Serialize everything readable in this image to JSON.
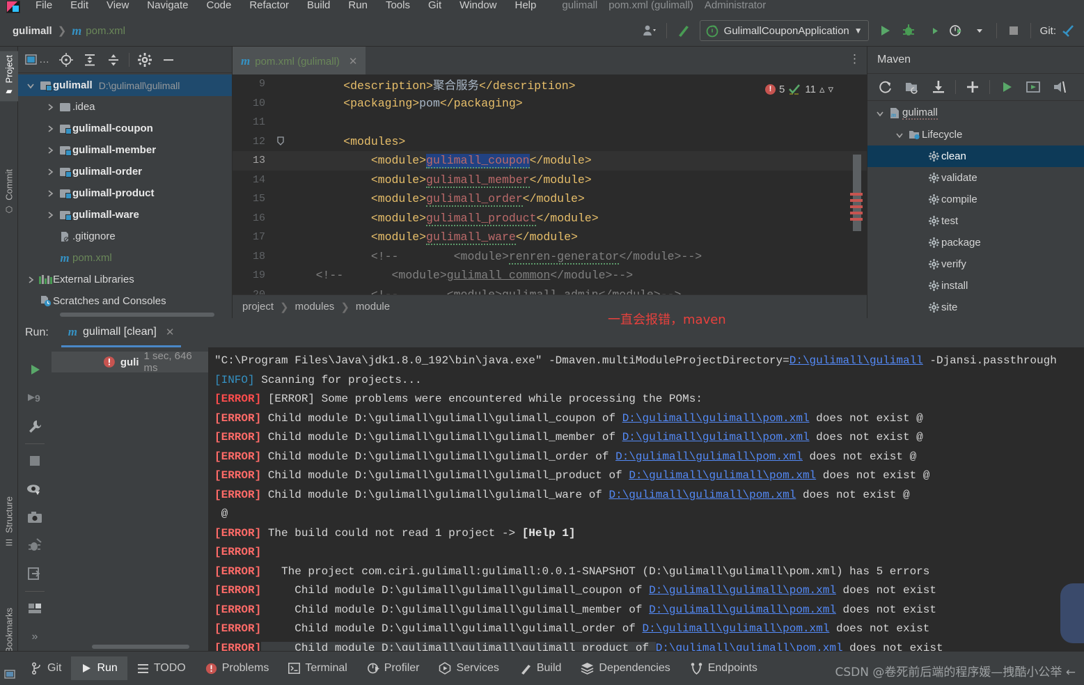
{
  "menu": {
    "items": [
      "File",
      "Edit",
      "View",
      "Navigate",
      "Code",
      "Refactor",
      "Build",
      "Run",
      "Tools",
      "Git",
      "Window",
      "Help"
    ],
    "window_title": [
      "gulimall",
      "pom.xml (gulimall)",
      "Administrator"
    ]
  },
  "toolbar": {
    "breadcrumb_project": "gulimall",
    "breadcrumb_file": "pom.xml",
    "m_icon": "m",
    "run_config": "GulimallCouponApplication",
    "git_label": "Git:",
    "icons": [
      "user-icon",
      "build-hammer-icon",
      "run-icon",
      "debug-icon",
      "run-with-coverage-icon",
      "profiler-icon",
      "stop-icon",
      "git-update-icon"
    ]
  },
  "left_strip": {
    "tabs": [
      {
        "label": "Project",
        "icon": "folder-icon",
        "selected": true
      },
      {
        "label": "Commit",
        "icon": "commit-icon",
        "selected": false
      },
      {
        "label": "Structure",
        "icon": "structure-icon",
        "selected": false
      },
      {
        "label": "Bookmarks",
        "icon": "bookmark-icon",
        "selected": false
      }
    ]
  },
  "project_window": {
    "toolbar_icons": [
      "project-view-select",
      "locate-icon",
      "expand-all-icon",
      "collapse-all-icon",
      "settings-gear-icon",
      "hide-icon"
    ],
    "tree": [
      {
        "label": "gulimall",
        "path": "D:\\gulimall\\gulimall",
        "depth": 0,
        "twist": "expanded",
        "icon": "module-folder-icon",
        "bold": true,
        "selected": true
      },
      {
        "label": ".idea",
        "path": "",
        "depth": 1,
        "twist": "collapsed",
        "icon": "folder-icon",
        "bold": false,
        "selected": false
      },
      {
        "label": "gulimall-coupon",
        "path": "",
        "depth": 1,
        "twist": "collapsed",
        "icon": "module-folder-icon",
        "bold": true,
        "selected": false
      },
      {
        "label": "gulimall-member",
        "path": "",
        "depth": 1,
        "twist": "collapsed",
        "icon": "module-folder-icon",
        "bold": true,
        "selected": false
      },
      {
        "label": "gulimall-order",
        "path": "",
        "depth": 1,
        "twist": "collapsed",
        "icon": "module-folder-icon",
        "bold": true,
        "selected": false
      },
      {
        "label": "gulimall-product",
        "path": "",
        "depth": 1,
        "twist": "collapsed",
        "icon": "module-folder-icon",
        "bold": true,
        "selected": false
      },
      {
        "label": "gulimall-ware",
        "path": "",
        "depth": 1,
        "twist": "collapsed",
        "icon": "module-folder-icon",
        "bold": true,
        "selected": false
      },
      {
        "label": ".gitignore",
        "path": "",
        "depth": 1,
        "twist": "none",
        "icon": "gitignore-file-icon",
        "bold": false,
        "selected": false
      },
      {
        "label": "pom.xml",
        "path": "",
        "depth": 1,
        "twist": "none",
        "icon": "maven-file-icon",
        "bold": false,
        "selected": false
      },
      {
        "label": "External Libraries",
        "path": "",
        "depth": 0,
        "twist": "collapsed",
        "icon": "libraries-icon",
        "bold": false,
        "selected": false
      },
      {
        "label": "Scratches and Consoles",
        "path": "",
        "depth": 0,
        "twist": "none",
        "icon": "scratches-icon",
        "bold": false,
        "selected": false
      }
    ]
  },
  "editor": {
    "tab_label": "pom.xml (gulimall)",
    "tab_icon": "maven-file-icon",
    "inspection": {
      "error_count": "5",
      "warning_count": "11",
      "error_glyph": "!",
      "check_glyph": "✓"
    },
    "breadcrumb": [
      "project",
      "modules",
      "module"
    ],
    "annotation": "一直会报错，maven",
    "lines": [
      {
        "num": "9",
        "indent": 8,
        "fold": false,
        "current": false,
        "parts": [
          {
            "t": "tag",
            "s": "<description>"
          },
          {
            "t": "txt",
            "s": "聚合服务"
          },
          {
            "t": "tag",
            "s": "</description>"
          }
        ]
      },
      {
        "num": "10",
        "indent": 8,
        "fold": false,
        "current": false,
        "parts": [
          {
            "t": "tag",
            "s": "<packaging>"
          },
          {
            "t": "txt",
            "s": "pom"
          },
          {
            "t": "tag",
            "s": "</packaging>"
          }
        ]
      },
      {
        "num": "11",
        "indent": 0,
        "fold": false,
        "current": false,
        "parts": []
      },
      {
        "num": "12",
        "indent": 8,
        "fold": true,
        "current": false,
        "parts": [
          {
            "t": "tag",
            "s": "<modules>"
          }
        ]
      },
      {
        "num": "13",
        "indent": 12,
        "fold": false,
        "current": true,
        "parts": [
          {
            "t": "tag",
            "s": "<module>"
          },
          {
            "t": "sel",
            "s": "gulimall_coupon"
          },
          {
            "t": "tag",
            "s": "</module>"
          }
        ]
      },
      {
        "num": "14",
        "indent": 12,
        "fold": false,
        "current": false,
        "parts": [
          {
            "t": "tag",
            "s": "<module>"
          },
          {
            "t": "valw",
            "s": "gulimall_member"
          },
          {
            "t": "tag",
            "s": "</module>"
          }
        ]
      },
      {
        "num": "15",
        "indent": 12,
        "fold": false,
        "current": false,
        "parts": [
          {
            "t": "tag",
            "s": "<module>"
          },
          {
            "t": "valw",
            "s": "gulimall_order"
          },
          {
            "t": "tag",
            "s": "</module>"
          }
        ]
      },
      {
        "num": "16",
        "indent": 12,
        "fold": false,
        "current": false,
        "parts": [
          {
            "t": "tag",
            "s": "<module>"
          },
          {
            "t": "valw",
            "s": "gulimall_product"
          },
          {
            "t": "tag",
            "s": "</module>"
          }
        ]
      },
      {
        "num": "17",
        "indent": 12,
        "fold": false,
        "current": false,
        "parts": [
          {
            "t": "tag",
            "s": "<module>"
          },
          {
            "t": "valw",
            "s": "gulimall_ware"
          },
          {
            "t": "tag",
            "s": "</module>"
          }
        ]
      },
      {
        "num": "18",
        "indent": 12,
        "fold": false,
        "current": false,
        "parts": [
          {
            "t": "cmt",
            "s": "<!--        <module>"
          },
          {
            "t": "cmtw",
            "s": "renren-generator"
          },
          {
            "t": "cmt",
            "s": "</module>-->"
          }
        ]
      },
      {
        "num": "19",
        "indent": 4,
        "fold": false,
        "current": false,
        "parts": [
          {
            "t": "cmt",
            "s": "<!--       <module>"
          },
          {
            "t": "cmtu",
            "s": "gulimall_common"
          },
          {
            "t": "cmt",
            "s": "</module>-->"
          }
        ]
      },
      {
        "num": "20",
        "indent": 12,
        "fold": false,
        "current": false,
        "parts": [
          {
            "t": "cmt",
            "s": "<!--       <module>gulimall_admin</module>-->"
          }
        ]
      }
    ]
  },
  "maven_window": {
    "title": "Maven",
    "toolbar_icons": [
      "reload-icon",
      "add-maven-projects-icon",
      "download-sources-icon",
      "plus-icon",
      "run-icon",
      "execute-goal-icon",
      "toggle-offline-icon"
    ],
    "tree": [
      {
        "label": "gulimall",
        "depth": 0,
        "twist": "expanded",
        "icon": "maven-project-icon",
        "selected": false
      },
      {
        "label": "Lifecycle",
        "depth": 1,
        "twist": "expanded",
        "icon": "lifecycle-folder-icon",
        "selected": false
      },
      {
        "label": "clean",
        "depth": 2,
        "twist": "none",
        "icon": "goal-gear-icon",
        "selected": true
      },
      {
        "label": "validate",
        "depth": 2,
        "twist": "none",
        "icon": "goal-gear-icon",
        "selected": false
      },
      {
        "label": "compile",
        "depth": 2,
        "twist": "none",
        "icon": "goal-gear-icon",
        "selected": false
      },
      {
        "label": "test",
        "depth": 2,
        "twist": "none",
        "icon": "goal-gear-icon",
        "selected": false
      },
      {
        "label": "package",
        "depth": 2,
        "twist": "none",
        "icon": "goal-gear-icon",
        "selected": false
      },
      {
        "label": "verify",
        "depth": 2,
        "twist": "none",
        "icon": "goal-gear-icon",
        "selected": false
      },
      {
        "label": "install",
        "depth": 2,
        "twist": "none",
        "icon": "goal-gear-icon",
        "selected": false
      },
      {
        "label": "site",
        "depth": 2,
        "twist": "none",
        "icon": "goal-gear-icon",
        "selected": false
      }
    ]
  },
  "run_window": {
    "label": "Run:",
    "tab_label": "gulimall [clean]",
    "tab_icon": "maven-file-icon",
    "side_icons": [
      "rerun-icon",
      "rerun-failed-icon",
      "configure-wrench-icon",
      "stop-icon",
      "toggle-tasks-icon",
      "screenshot-icon",
      "debug-icon",
      "export-icon",
      "layout-icon",
      "more-icon"
    ],
    "tree_node": {
      "name": "guli",
      "time": "1 sec, 646 ms",
      "icon": "error-badge-icon"
    },
    "console": [
      {
        "parts": [
          {
            "t": "n",
            "s": "\"C:\\Program Files\\Java\\jdk1.8.0_192\\bin\\java.exe\" -Dmaven.multiModuleProjectDirectory="
          },
          {
            "t": "lnk",
            "s": "D:\\gulimall\\gulimall"
          },
          {
            "t": "n",
            "s": " -Djansi.passthrough"
          }
        ]
      },
      {
        "parts": [
          {
            "t": "info",
            "s": "[INFO]"
          },
          {
            "t": "n",
            "s": " Scanning for projects..."
          }
        ]
      },
      {
        "parts": [
          {
            "t": "errb",
            "s": "[ERROR]"
          },
          {
            "t": "n",
            "s": " [ERROR] Some problems were encountered while processing the POMs:"
          }
        ]
      },
      {
        "parts": [
          {
            "t": "err",
            "s": "[ERROR]"
          },
          {
            "t": "n",
            "s": " Child module D:\\gulimall\\gulimall\\gulimall_coupon of "
          },
          {
            "t": "lnk",
            "s": "D:\\gulimall\\gulimall\\pom.xml"
          },
          {
            "t": "n",
            "s": " does not exist @"
          }
        ]
      },
      {
        "parts": [
          {
            "t": "err",
            "s": "[ERROR]"
          },
          {
            "t": "n",
            "s": " Child module D:\\gulimall\\gulimall\\gulimall_member of "
          },
          {
            "t": "lnk",
            "s": "D:\\gulimall\\gulimall\\pom.xml"
          },
          {
            "t": "n",
            "s": " does not exist @"
          }
        ]
      },
      {
        "parts": [
          {
            "t": "err",
            "s": "[ERROR]"
          },
          {
            "t": "n",
            "s": " Child module D:\\gulimall\\gulimall\\gulimall_order of "
          },
          {
            "t": "lnk",
            "s": "D:\\gulimall\\gulimall\\pom.xml"
          },
          {
            "t": "n",
            "s": " does not exist @"
          }
        ]
      },
      {
        "parts": [
          {
            "t": "err",
            "s": "[ERROR]"
          },
          {
            "t": "n",
            "s": " Child module D:\\gulimall\\gulimall\\gulimall_product of "
          },
          {
            "t": "lnk",
            "s": "D:\\gulimall\\gulimall\\pom.xml"
          },
          {
            "t": "n",
            "s": " does not exist @"
          }
        ]
      },
      {
        "parts": [
          {
            "t": "err",
            "s": "[ERROR]"
          },
          {
            "t": "n",
            "s": " Child module D:\\gulimall\\gulimall\\gulimall_ware of "
          },
          {
            "t": "lnk",
            "s": "D:\\gulimall\\gulimall\\pom.xml"
          },
          {
            "t": "n",
            "s": " does not exist @"
          }
        ]
      },
      {
        "parts": [
          {
            "t": "n",
            "s": " @"
          }
        ]
      },
      {
        "parts": [
          {
            "t": "err",
            "s": "[ERROR]"
          },
          {
            "t": "n",
            "s": " The build could not read 1 project -> "
          },
          {
            "t": "boldw",
            "s": "[Help 1]"
          }
        ]
      },
      {
        "parts": [
          {
            "t": "err",
            "s": "[ERROR]"
          }
        ]
      },
      {
        "parts": [
          {
            "t": "err",
            "s": "[ERROR]"
          },
          {
            "t": "n",
            "s": "   The project com.ciri.gulimall:gulimall:0.0.1-SNAPSHOT (D:\\gulimall\\gulimall\\pom.xml) has 5 errors"
          }
        ]
      },
      {
        "parts": [
          {
            "t": "err",
            "s": "[ERROR]"
          },
          {
            "t": "n",
            "s": "     Child module D:\\gulimall\\gulimall\\gulimall_coupon of "
          },
          {
            "t": "lnk",
            "s": "D:\\gulimall\\gulimall\\pom.xml"
          },
          {
            "t": "n",
            "s": " does not exist"
          }
        ]
      },
      {
        "parts": [
          {
            "t": "err",
            "s": "[ERROR]"
          },
          {
            "t": "n",
            "s": "     Child module D:\\gulimall\\gulimall\\gulimall_member of "
          },
          {
            "t": "lnk",
            "s": "D:\\gulimall\\gulimall\\pom.xml"
          },
          {
            "t": "n",
            "s": " does not exist"
          }
        ]
      },
      {
        "parts": [
          {
            "t": "err",
            "s": "[ERROR]"
          },
          {
            "t": "n",
            "s": "     Child module D:\\gulimall\\gulimall\\gulimall_order of "
          },
          {
            "t": "lnk",
            "s": "D:\\gulimall\\gulimall\\pom.xml"
          },
          {
            "t": "n",
            "s": " does not exist"
          }
        ]
      },
      {
        "parts": [
          {
            "t": "err",
            "s": "[ERROR]"
          },
          {
            "t": "hl",
            "s": "     Child module D:\\gulimall\\gulimall\\gulimall_product of "
          },
          {
            "t": "lnk",
            "s": "D:\\gulimall\\gulimall\\pom.xml"
          },
          {
            "t": "n",
            "s": " does not exist"
          }
        ]
      }
    ]
  },
  "status_bar": {
    "items": [
      {
        "label": "Git",
        "icon": "git-branch-icon",
        "selected": false
      },
      {
        "label": "Run",
        "icon": "run-play-icon",
        "selected": true
      },
      {
        "label": "TODO",
        "icon": "todo-list-icon",
        "selected": false
      },
      {
        "label": "Problems",
        "icon": "problems-error-icon",
        "selected": false
      },
      {
        "label": "Terminal",
        "icon": "terminal-icon",
        "selected": false
      },
      {
        "label": "Profiler",
        "icon": "profiler-icon",
        "selected": false
      },
      {
        "label": "Services",
        "icon": "services-icon",
        "selected": false
      },
      {
        "label": "Build",
        "icon": "build-hammer-icon",
        "selected": false
      },
      {
        "label": "Dependencies",
        "icon": "dependencies-icon",
        "selected": false
      },
      {
        "label": "Endpoints",
        "icon": "endpoints-icon",
        "selected": false
      }
    ],
    "watermark": "CSDN @卷死前后端的程序媛—拽酷小公举 ←"
  }
}
